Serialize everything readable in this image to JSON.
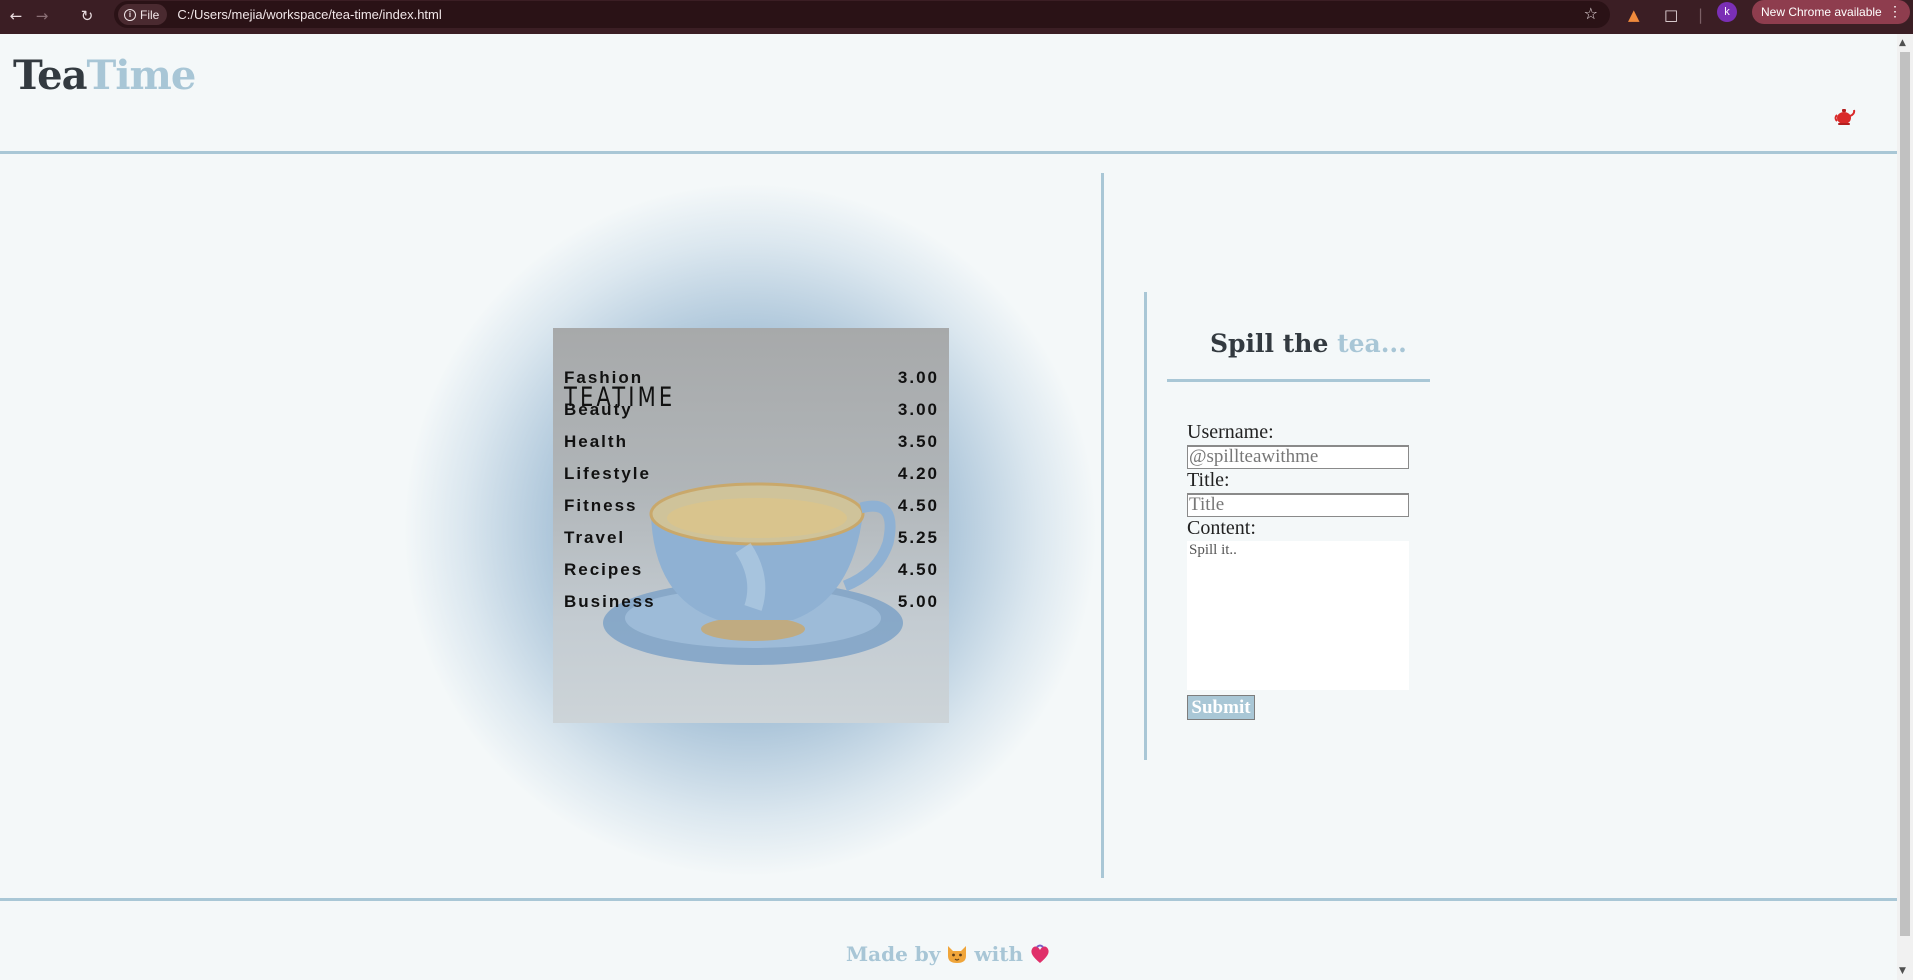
{
  "browser": {
    "file_chip": "File",
    "url": "C:/Users/mejia/workspace/tea-time/index.html",
    "avatar_letter": "k",
    "update_label": "New Chrome available"
  },
  "header": {
    "logo_part1": "Tea",
    "logo_part2": "Time",
    "icon": "teapot-icon"
  },
  "menu": {
    "title": "TEATIME",
    "items": [
      {
        "name": "Fashion",
        "price": "3.00"
      },
      {
        "name": "Beauty",
        "price": "3.00"
      },
      {
        "name": "Health",
        "price": "3.50"
      },
      {
        "name": "Lifestyle",
        "price": "4.20"
      },
      {
        "name": "Fitness",
        "price": "4.50"
      },
      {
        "name": "Travel",
        "price": "5.25"
      },
      {
        "name": "Recipes",
        "price": "4.50"
      },
      {
        "name": "Business",
        "price": "5.00"
      }
    ]
  },
  "form": {
    "title_part1": "Spill the",
    "title_part2": "tea...",
    "username_label": "Username:",
    "username_placeholder": "@spillteawithme",
    "title_label": "Title:",
    "title_placeholder": "Title",
    "content_label": "Content:",
    "content_placeholder": "Spill it..",
    "submit_label": "Submit"
  },
  "footer": {
    "made_by": "Made by",
    "with": "with",
    "icons": [
      "cat-icon",
      "heart-icon"
    ]
  },
  "colors": {
    "accent": "#a8c6d6",
    "dark_text": "#333a40",
    "background": "#f4f8f9",
    "browser_frame": "#3b1e24"
  }
}
